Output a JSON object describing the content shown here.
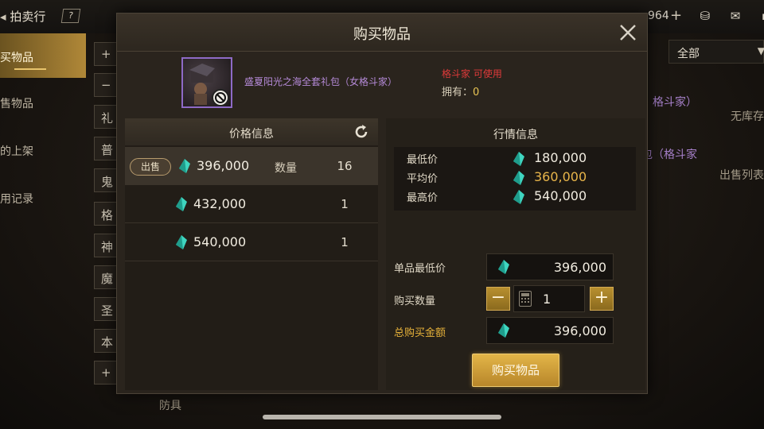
{
  "top": {
    "title": "拍卖行",
    "help": "?",
    "currency_value": "964"
  },
  "sidebar": {
    "items": [
      {
        "label": "买物品"
      },
      {
        "label": "售物品"
      },
      {
        "label": "的上架"
      },
      {
        "label": "用记录"
      }
    ]
  },
  "categories": [
    "+",
    "−",
    "礼",
    "普",
    "鬼",
    "格",
    "神",
    "魔",
    "圣",
    "本",
    "+"
  ],
  "bg_list": {
    "filter_value": "全部",
    "row1_title": "）格斗家）",
    "row1_status": "无库存",
    "row2_title": "包（格斗家",
    "row2_status": "出售列表",
    "bottom_text": "防具"
  },
  "modal": {
    "title": "购买物品",
    "item": {
      "name": "盛夏阳光之海全套礼包（女格斗家）",
      "class_note": "格斗家 可使用",
      "owned_label": "拥有：",
      "owned_value": "0"
    },
    "price_info": {
      "header": "价格信息",
      "qty_label": "数量",
      "sell_badge": "出售",
      "rows": [
        {
          "price": "396,000",
          "qty": "16"
        },
        {
          "price": "432,000",
          "qty": "1"
        },
        {
          "price": "540,000",
          "qty": "1"
        }
      ]
    },
    "market_info": {
      "header": "行情信息",
      "min_label": "最低价",
      "min_value": "180,000",
      "avg_label": "平均价",
      "avg_value": "360,000",
      "max_label": "最高价",
      "max_value": "540,000"
    },
    "purchase": {
      "unit_min_label": "单品最低价",
      "unit_min_value": "396,000",
      "qty_label": "购买数量",
      "qty_value": "1",
      "total_label": "总购买金额",
      "total_value": "396,000",
      "minus": "−",
      "plus": "+",
      "buy_button": "购买物品"
    }
  },
  "colors": {
    "accent_gold": "#e3b548",
    "gem_cyan": "#3fd6c0",
    "item_purple": "#b58ad8",
    "warning_red": "#e03a3a"
  }
}
